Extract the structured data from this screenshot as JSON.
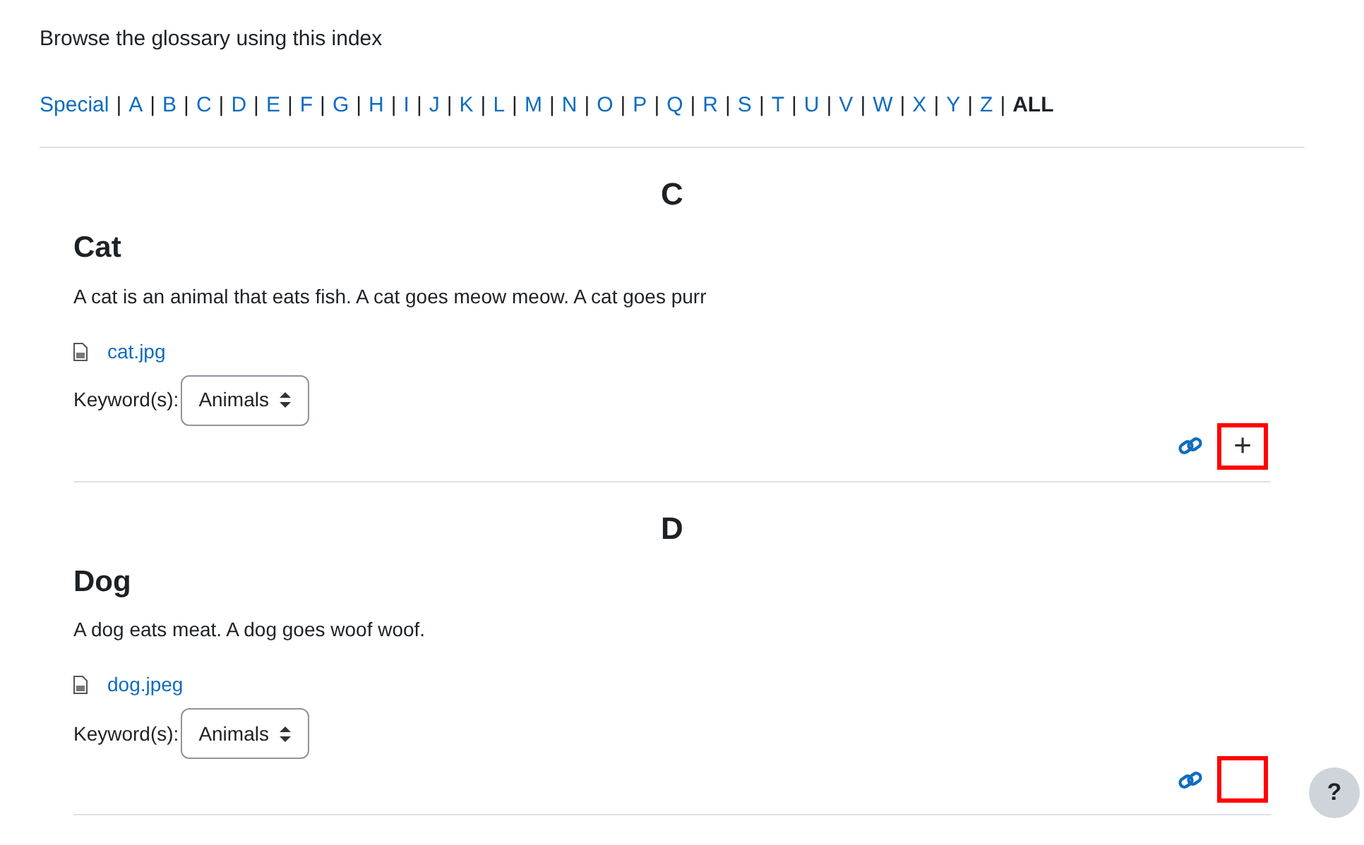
{
  "intro": "Browse the glossary using this index",
  "index": {
    "separator": "|",
    "items": [
      {
        "label": "Special",
        "selected": false
      },
      {
        "label": "A",
        "selected": false
      },
      {
        "label": "B",
        "selected": false
      },
      {
        "label": "C",
        "selected": false
      },
      {
        "label": "D",
        "selected": false
      },
      {
        "label": "E",
        "selected": false
      },
      {
        "label": "F",
        "selected": false
      },
      {
        "label": "G",
        "selected": false
      },
      {
        "label": "H",
        "selected": false
      },
      {
        "label": "I",
        "selected": false
      },
      {
        "label": "J",
        "selected": false
      },
      {
        "label": "K",
        "selected": false
      },
      {
        "label": "L",
        "selected": false
      },
      {
        "label": "M",
        "selected": false
      },
      {
        "label": "N",
        "selected": false
      },
      {
        "label": "O",
        "selected": false
      },
      {
        "label": "P",
        "selected": false
      },
      {
        "label": "Q",
        "selected": false
      },
      {
        "label": "R",
        "selected": false
      },
      {
        "label": "S",
        "selected": false
      },
      {
        "label": "T",
        "selected": false
      },
      {
        "label": "U",
        "selected": false
      },
      {
        "label": "V",
        "selected": false
      },
      {
        "label": "W",
        "selected": false
      },
      {
        "label": "X",
        "selected": false
      },
      {
        "label": "Y",
        "selected": false
      },
      {
        "label": "Z",
        "selected": false
      },
      {
        "label": "ALL",
        "selected": true
      }
    ]
  },
  "entries": [
    {
      "letter": "C",
      "title": "Cat",
      "definition": "A cat is an animal that eats fish. A cat goes meow meow. A cat goes purr",
      "attachment": "cat.jpg",
      "keyword_label": "Keyword(s):",
      "keyword": "Animals",
      "action": "+"
    },
    {
      "letter": "D",
      "title": "Dog",
      "definition": "A dog eats meat. A dog goes woof woof.",
      "attachment": "dog.jpeg",
      "keyword_label": "Keyword(s):",
      "keyword": "Animals"
    }
  ],
  "help": "?"
}
